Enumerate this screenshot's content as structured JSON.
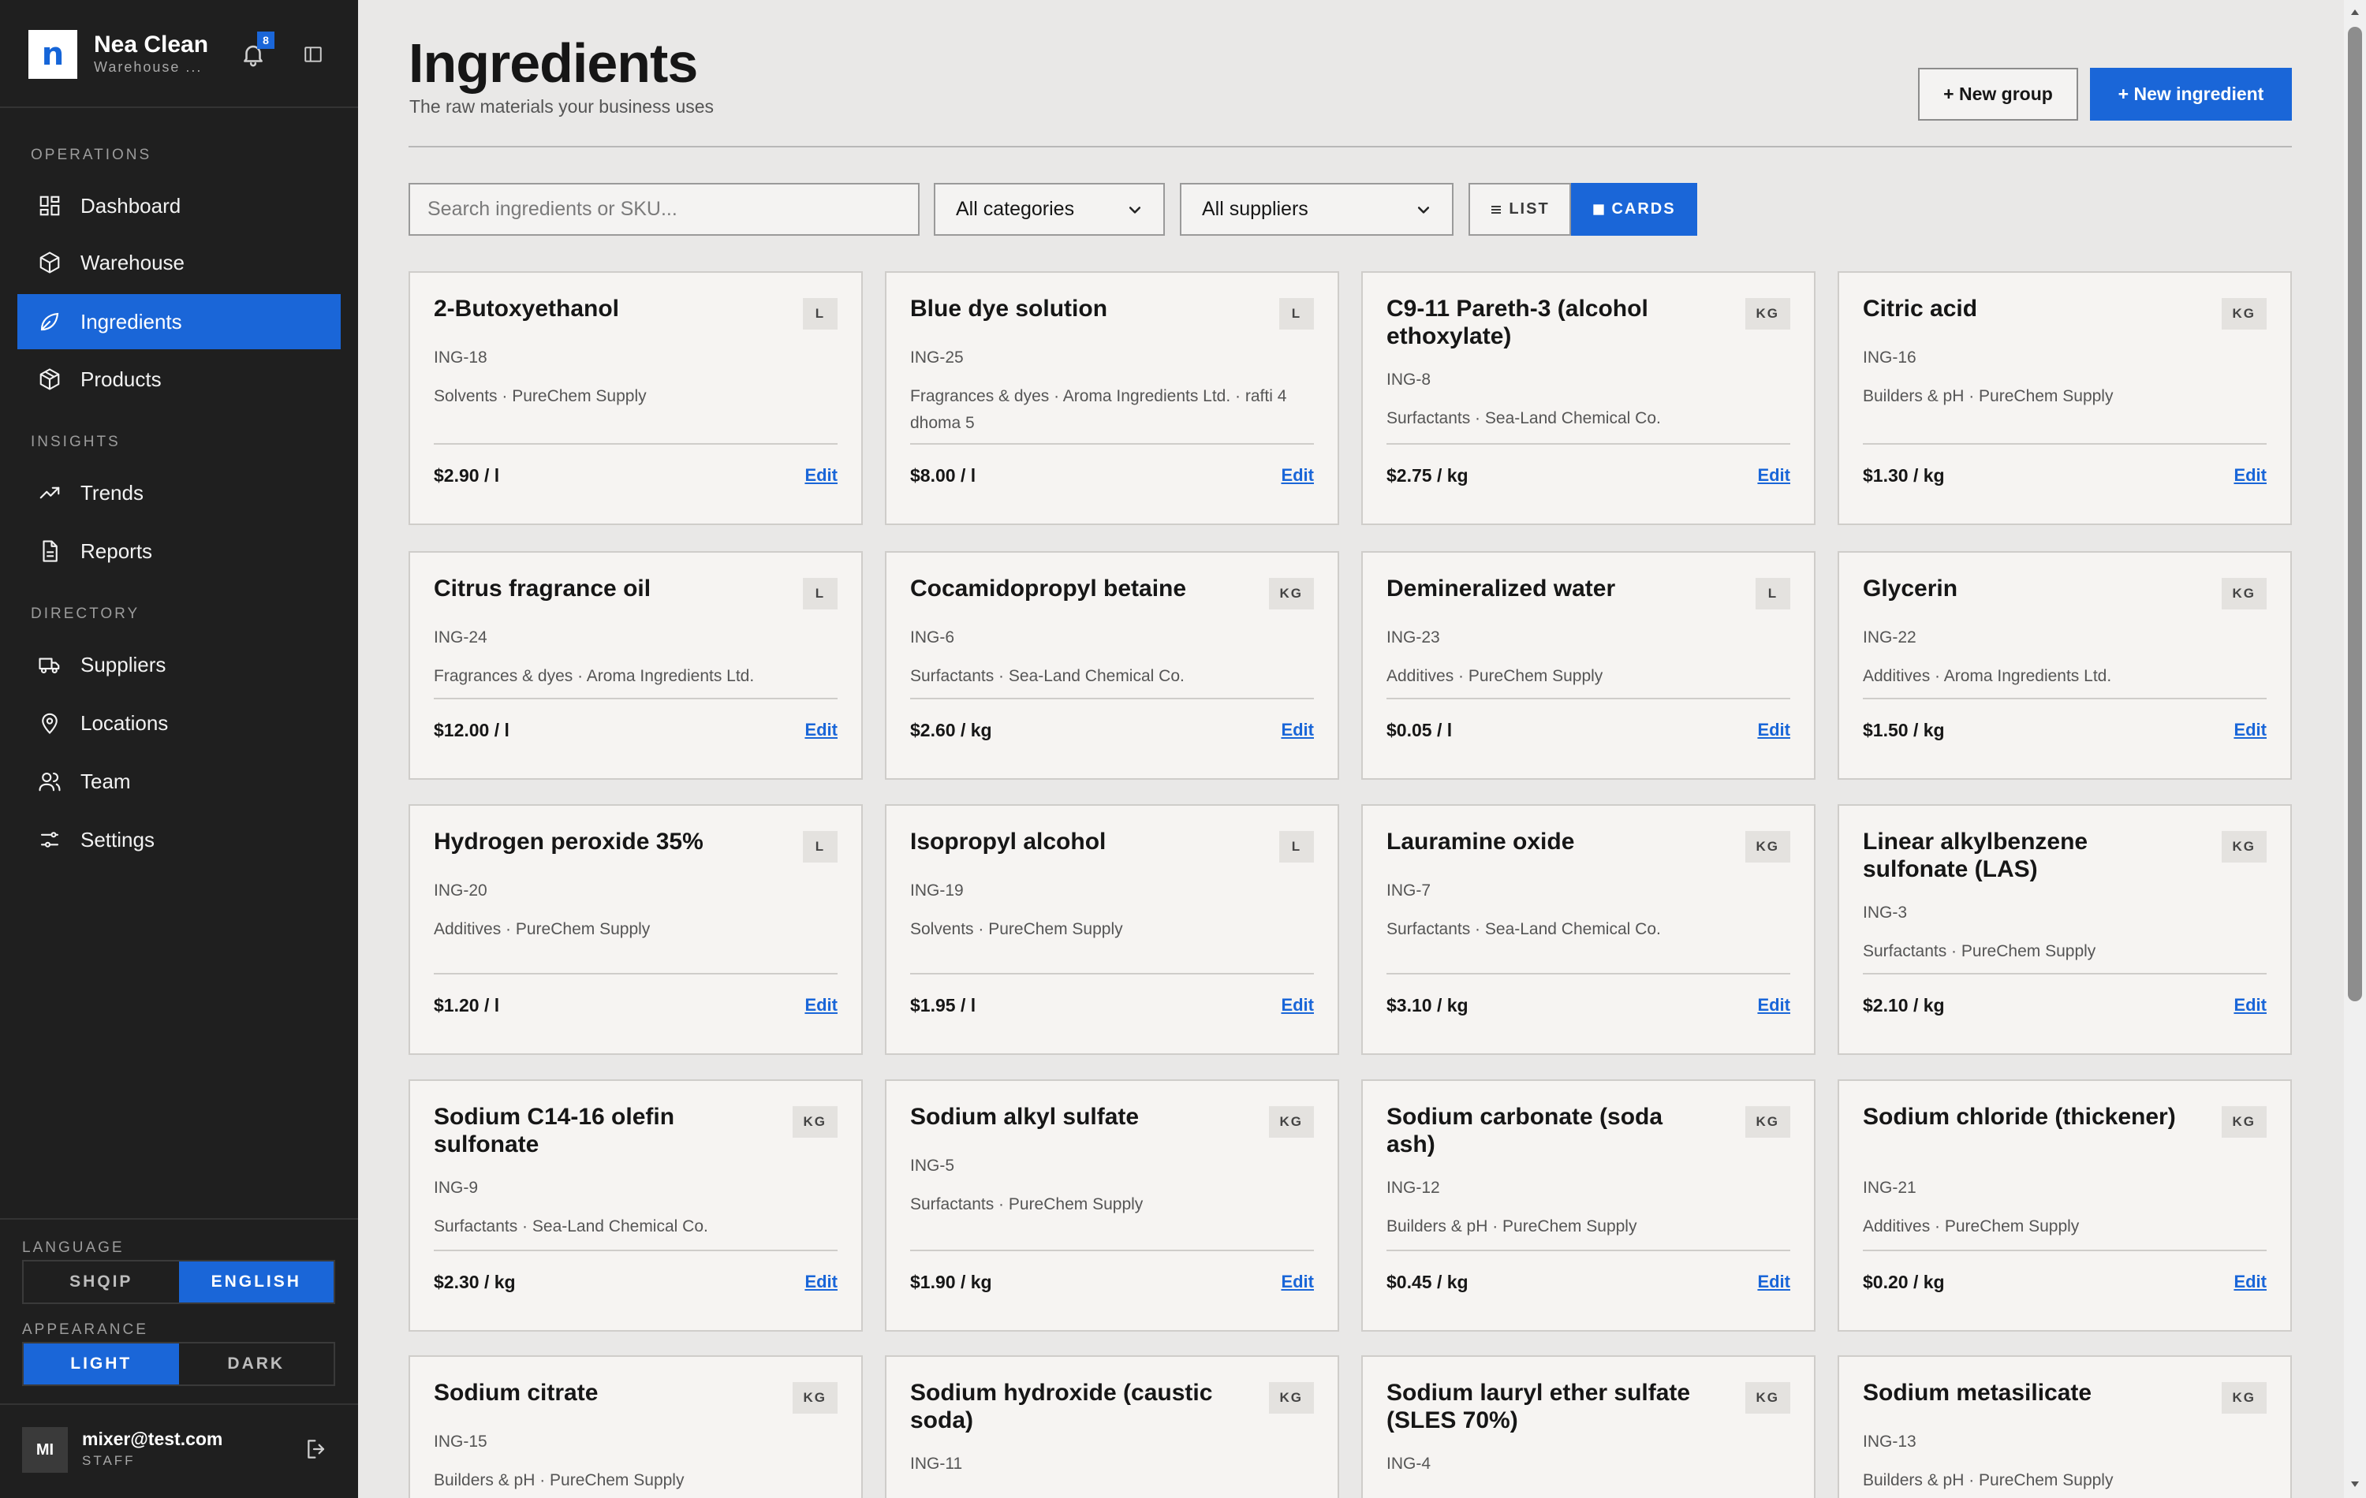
{
  "brand": {
    "name": "Nea Clean",
    "subtitle": "Warehouse ...",
    "logo_letter": "n",
    "notifications": "8"
  },
  "nav": {
    "sections": [
      {
        "label": "OPERATIONS"
      },
      {
        "label": "INSIGHTS"
      },
      {
        "label": "DIRECTORY"
      }
    ],
    "items": [
      {
        "label": "Dashboard",
        "icon": "dashboard-grid-icon",
        "active": false
      },
      {
        "label": "Warehouse",
        "icon": "box-icon",
        "active": false
      },
      {
        "label": "Ingredients",
        "icon": "leaf-icon",
        "active": true
      },
      {
        "label": "Products",
        "icon": "package-icon",
        "active": false
      },
      {
        "label": "Trends",
        "icon": "trend-up-icon",
        "active": false
      },
      {
        "label": "Reports",
        "icon": "document-icon",
        "active": false
      },
      {
        "label": "Suppliers",
        "icon": "truck-icon",
        "active": false
      },
      {
        "label": "Locations",
        "icon": "map-pin-icon",
        "active": false
      },
      {
        "label": "Team",
        "icon": "users-icon",
        "active": false
      },
      {
        "label": "Settings",
        "icon": "sliders-icon",
        "active": false
      }
    ]
  },
  "language": {
    "label": "LANGUAGE",
    "options": [
      "SHQIP",
      "ENGLISH"
    ],
    "selected": "ENGLISH"
  },
  "appearance": {
    "label": "APPEARANCE",
    "options": [
      "LIGHT",
      "DARK"
    ],
    "selected": "LIGHT"
  },
  "user": {
    "initials": "MI",
    "email": "mixer@test.com",
    "role": "STAFF"
  },
  "header": {
    "title": "Ingredients",
    "subtitle": "The raw materials your business uses",
    "new_group": "+ New group",
    "new_ingredient": "+ New ingredient"
  },
  "filters": {
    "search_placeholder": "Search ingredients or SKU...",
    "category": "All categories",
    "supplier": "All suppliers",
    "view_list": "LIST",
    "view_cards": "CARDS"
  },
  "colors": {
    "accent": "#1a66d8",
    "sidebar": "#1f1f1f",
    "background": "#e9e8e7",
    "card": "#f6f4f2"
  },
  "edit_label": "Edit",
  "ingredients": [
    {
      "name": "2-Butoxyethanol",
      "unit": "L",
      "sku": "ING-18",
      "meta": "Solvents · PureChem Supply",
      "price": "$2.90 / l"
    },
    {
      "name": "Blue dye solution",
      "unit": "L",
      "sku": "ING-25",
      "meta": "Fragrances & dyes · Aroma Ingredients Ltd. · rafti 4 dhoma 5",
      "price": "$8.00 / l"
    },
    {
      "name": "C9-11 Pareth-3 (alcohol ethoxylate)",
      "unit": "KG",
      "sku": "ING-8",
      "meta": "Surfactants · Sea-Land Chemical Co.",
      "price": "$2.75 / kg"
    },
    {
      "name": "Citric acid",
      "unit": "KG",
      "sku": "ING-16",
      "meta": "Builders & pH · PureChem Supply",
      "price": "$1.30 / kg"
    },
    {
      "name": "Citrus fragrance oil",
      "unit": "L",
      "sku": "ING-24",
      "meta": "Fragrances & dyes · Aroma Ingredients Ltd.",
      "price": "$12.00 / l"
    },
    {
      "name": "Cocamidopropyl betaine",
      "unit": "KG",
      "sku": "ING-6",
      "meta": "Surfactants · Sea-Land Chemical Co.",
      "price": "$2.60 / kg"
    },
    {
      "name": "Demineralized water",
      "unit": "L",
      "sku": "ING-23",
      "meta": "Additives · PureChem Supply",
      "price": "$0.05 / l"
    },
    {
      "name": "Glycerin",
      "unit": "KG",
      "sku": "ING-22",
      "meta": "Additives · Aroma Ingredients Ltd.",
      "price": "$1.50 / kg"
    },
    {
      "name": "Hydrogen peroxide 35%",
      "unit": "L",
      "sku": "ING-20",
      "meta": "Additives · PureChem Supply",
      "price": "$1.20 / l"
    },
    {
      "name": "Isopropyl alcohol",
      "unit": "L",
      "sku": "ING-19",
      "meta": "Solvents · PureChem Supply",
      "price": "$1.95 / l"
    },
    {
      "name": "Lauramine oxide",
      "unit": "KG",
      "sku": "ING-7",
      "meta": "Surfactants · Sea-Land Chemical Co.",
      "price": "$3.10 / kg"
    },
    {
      "name": "Linear alkylbenzene sulfonate (LAS)",
      "unit": "KG",
      "sku": "ING-3",
      "meta": "Surfactants · PureChem Supply",
      "price": "$2.10 / kg"
    },
    {
      "name": "Sodium C14-16 olefin sulfonate",
      "unit": "KG",
      "sku": "ING-9",
      "meta": "Surfactants · Sea-Land Chemical Co.",
      "price": "$2.30 / kg"
    },
    {
      "name": "Sodium alkyl sulfate",
      "unit": "KG",
      "sku": "ING-5",
      "meta": "Surfactants · PureChem Supply",
      "price": "$1.90 / kg"
    },
    {
      "name": "Sodium carbonate (soda ash)",
      "unit": "KG",
      "sku": "ING-12",
      "meta": "Builders & pH · PureChem Supply",
      "price": "$0.45 / kg"
    },
    {
      "name": "Sodium chloride (thickener)",
      "unit": "KG",
      "sku": "ING-21",
      "meta": "Additives · PureChem Supply",
      "price": "$0.20 / kg"
    },
    {
      "name": "Sodium citrate",
      "unit": "KG",
      "sku": "ING-15",
      "meta": "Builders & pH · PureChem Supply",
      "price": ""
    },
    {
      "name": "Sodium hydroxide (caustic soda)",
      "unit": "KG",
      "sku": "ING-11",
      "meta": "",
      "price": ""
    },
    {
      "name": "Sodium lauryl ether sulfate (SLES 70%)",
      "unit": "KG",
      "sku": "ING-4",
      "meta": "",
      "price": ""
    },
    {
      "name": "Sodium metasilicate",
      "unit": "KG",
      "sku": "ING-13",
      "meta": "Builders & pH · PureChem Supply",
      "price": ""
    }
  ]
}
